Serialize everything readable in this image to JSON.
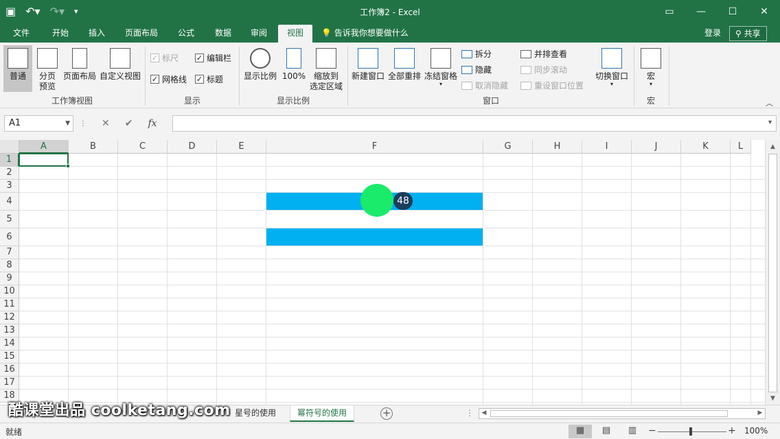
{
  "window": {
    "title": "工作簿2 - Excel",
    "qat_icons": [
      "save-icon",
      "undo-icon",
      "redo-icon",
      "customize-icon"
    ],
    "qat_glyphs": [
      "▣",
      "↶▾",
      "↷▾",
      "▾"
    ],
    "controls": [
      "▭",
      "—",
      "☐",
      "✕"
    ]
  },
  "ribbon_tabs": [
    "文件",
    "开始",
    "插入",
    "页面布局",
    "公式",
    "数据",
    "审阅",
    "视图"
  ],
  "active_tab": "视图",
  "tell_me": "告诉我你想要做什么",
  "login": "登录",
  "share": "共享",
  "ribbon": {
    "workbook_views": {
      "label": "工作簿视图",
      "normal": "普通",
      "page_break_1": "分页",
      "page_break_2": "预览",
      "page_layout": "页面布局",
      "custom_views": "自定义视图"
    },
    "show": {
      "label": "显示",
      "ruler": "标尺",
      "formula_bar": "编辑栏",
      "gridlines": "网格线",
      "headings": "标题"
    },
    "zoom": {
      "label": "显示比例",
      "zoom": "显示比例",
      "hundred": "100%",
      "to_selection_1": "缩放到",
      "to_selection_2": "选定区域"
    },
    "window": {
      "label": "窗口",
      "new_window": "新建窗口",
      "arrange_all": "全部重排",
      "freeze_panes": "冻结窗格",
      "split": "拆分",
      "hide": "隐藏",
      "unhide": "取消隐藏",
      "side_by_side": "并排查看",
      "sync_scroll": "同步滚动",
      "reset_position": "重设窗口位置",
      "switch_windows": "切换窗口"
    },
    "macros": {
      "label": "宏",
      "macros": "宏"
    }
  },
  "formula_bar": {
    "name_box": "A1",
    "formula": "",
    "cancel": "✕",
    "enter": "✔",
    "fx": "fx"
  },
  "grid": {
    "columns": [
      "A",
      "B",
      "C",
      "D",
      "E",
      "F",
      "G",
      "H",
      "I",
      "J",
      "K",
      "L"
    ],
    "rows": [
      "1",
      "2",
      "3",
      "4",
      "5",
      "6",
      "7",
      "8",
      "9",
      "10",
      "11",
      "12",
      "13",
      "14",
      "15",
      "16",
      "17",
      "18"
    ],
    "selected_cell": "A1",
    "fill_color": "#00b0f0",
    "filled_cells": [
      "F4",
      "F6"
    ]
  },
  "step_badge": "48",
  "sheets": [
    "星号的使用",
    "幂符号的使用"
  ],
  "active_sheet": "幂符号的使用",
  "watermark": "酷课堂出品 coolketang.com",
  "status": {
    "ready": "就绪",
    "zoom": "100%"
  },
  "colors": {
    "brand": "#217346",
    "cell_fill": "#00b0f0",
    "cursor": "#1aeb6a"
  }
}
